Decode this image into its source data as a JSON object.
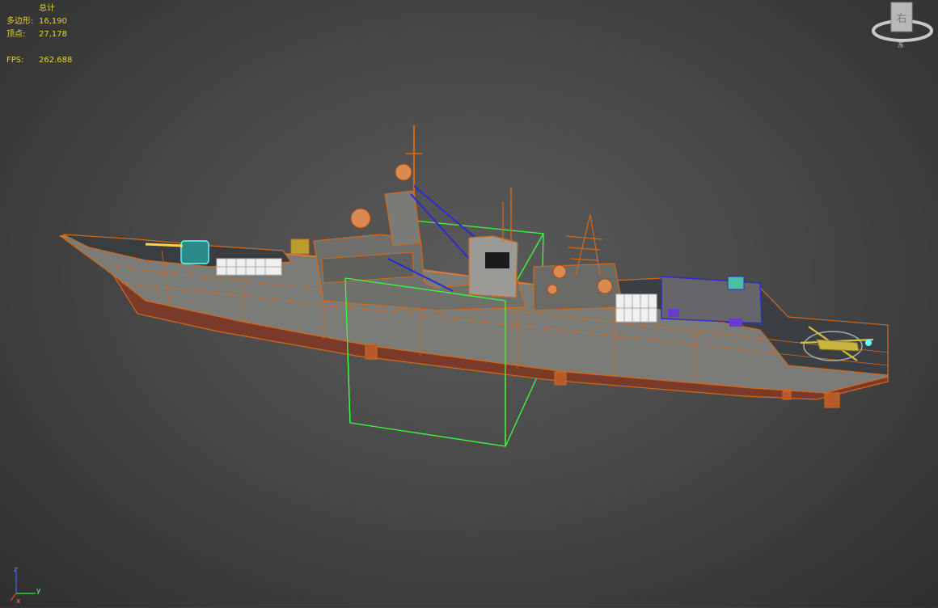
{
  "stats": {
    "title": "总计",
    "rows": [
      {
        "label": "多边形:",
        "value": "16,190"
      },
      {
        "label": "顶点:",
        "value": "27,178"
      }
    ],
    "fps_label": "FPS:",
    "fps_value": "262.688"
  },
  "viewcube": {
    "face_label": "右",
    "compass_label": "东"
  },
  "axis_gizmo": {
    "z": "z",
    "y": "y",
    "x": "x"
  },
  "colors": {
    "viewport_bg": "#4b4b4b",
    "stats_text": "#e6d23a",
    "wireframe": "#d2691e",
    "selection_box": "#3cff3c",
    "rigging": "#2a2ad0"
  }
}
